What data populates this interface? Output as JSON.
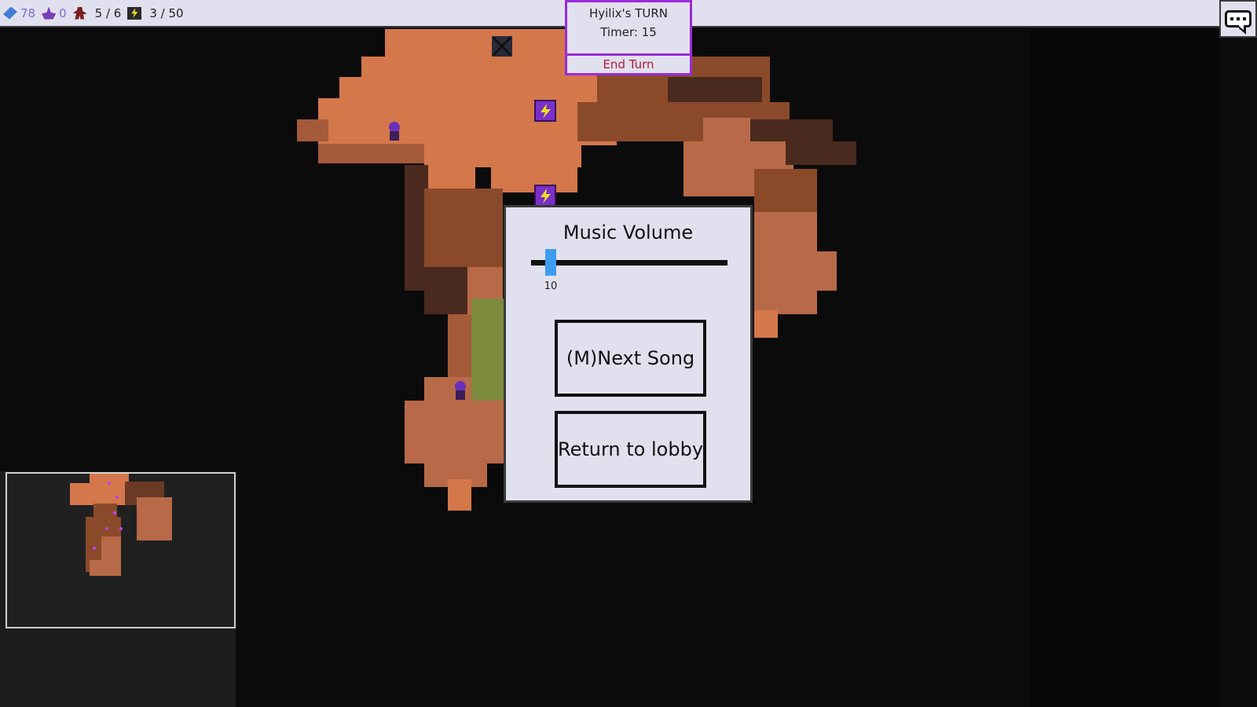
{
  "resources": {
    "gold": "78",
    "crystal": "0",
    "units": "5 / 6",
    "energy": "3 / 50"
  },
  "turn": {
    "player_turn": "Hyilix's TURN",
    "timer": "Timer: 15",
    "end_turn_label": "End Turn"
  },
  "settings_modal": {
    "title": "Music Volume",
    "volume_value": "10",
    "volume_fraction": 0.1,
    "next_song_label": "(M)Next Song",
    "return_label": "Return to lobby"
  },
  "colors": {
    "accent_purple": "#9a2bd8",
    "end_turn_red": "#b0163a",
    "slider_blue": "#3d9cf0",
    "panel_bg": "#e1e0ee"
  },
  "icons": {
    "gold": "blue-gem-icon",
    "crystal": "purple-crystal-icon",
    "units": "unit-icon",
    "energy": "lightning-icon",
    "chat": "chat-bubble-icon"
  }
}
